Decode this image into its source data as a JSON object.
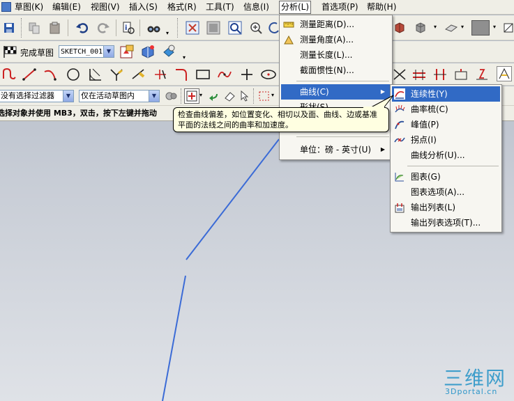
{
  "menubar": {
    "items": [
      "草图(K)",
      "编辑(E)",
      "视图(V)",
      "插入(S)",
      "格式(R)",
      "工具(T)",
      "信息(I)",
      "分析(L)",
      "首选项(P)",
      "帮助(H)"
    ],
    "active": "分析(L)"
  },
  "sketch_toolbar": {
    "finish_label": "完成草图",
    "sketch_name": "SKETCH_001"
  },
  "filter_toolbar": {
    "selection_filter": "没有选择过滤器",
    "scope": "仅在活动草图内"
  },
  "statusline": {
    "text": "选择对象并使用 MB3，双击，按下左键并拖动"
  },
  "analysis_menu": {
    "items": [
      {
        "label": "测量距离(D)...",
        "icon": "measure-distance-icon"
      },
      {
        "label": "测量角度(A)...",
        "icon": "measure-angle-icon"
      },
      {
        "label": "测量长度(L)...",
        "icon": ""
      },
      {
        "label": "截面惯性(N)...",
        "icon": ""
      },
      {
        "label": "曲线(C)",
        "icon": ""
      },
      {
        "label": "形状(S)",
        "icon": ""
      },
      {
        "label": "单位：磅 - 英寸(U)",
        "icon": ""
      }
    ],
    "highlighted": "曲线(C)"
  },
  "curve_submenu": {
    "items": [
      {
        "label": "连续性(Y)",
        "icon": "continuity-icon"
      },
      {
        "label": "曲率梳(C)",
        "icon": "curvature-comb-icon"
      },
      {
        "label": "峰值(P)",
        "icon": "peak-icon"
      },
      {
        "label": "拐点(I)",
        "icon": "inflection-icon"
      },
      {
        "label": "曲线分析(U)...",
        "icon": ""
      },
      {
        "label": "图表(G)",
        "icon": "graph-icon"
      },
      {
        "label": "图表选项(A)...",
        "icon": ""
      },
      {
        "label": "输出列表(L)",
        "icon": "output-list-icon"
      },
      {
        "label": "输出列表选项(T)...",
        "icon": ""
      }
    ],
    "highlighted": "连续性(Y)"
  },
  "tooltip": {
    "text": "检查曲线偏差，如位置变化、相切以及面、曲线、边或基准平面的法线之间的曲率和加速度。"
  },
  "watermark": {
    "brand": "三维网",
    "site": "3Dportal.cn"
  },
  "colors": {
    "highlight": "#316ac5",
    "curve": "#3b6bd6",
    "watermark": "#2f97c9"
  }
}
